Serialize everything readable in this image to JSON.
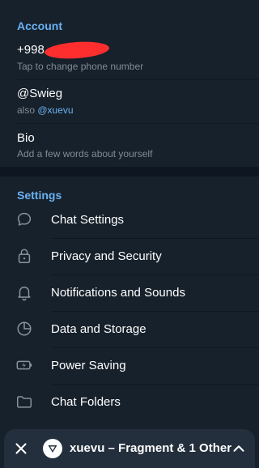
{
  "account": {
    "title": "Account",
    "phone": {
      "value": "+998",
      "hint": "Tap to change phone number"
    },
    "username": {
      "value": "@Swieg",
      "hint_prefix": "also ",
      "hint_mention": "@xuevu"
    },
    "bio": {
      "value": "Bio",
      "hint": "Add a few words about yourself"
    }
  },
  "settings": {
    "title": "Settings",
    "items": [
      {
        "label": "Chat Settings",
        "icon": "chat-bubble-icon"
      },
      {
        "label": "Privacy and Security",
        "icon": "lock-icon"
      },
      {
        "label": "Notifications and Sounds",
        "icon": "bell-icon"
      },
      {
        "label": "Data and Storage",
        "icon": "pie-clock-icon"
      },
      {
        "label": "Power Saving",
        "icon": "battery-icon"
      },
      {
        "label": "Chat Folders",
        "icon": "folder-icon"
      }
    ]
  },
  "bottom_bar": {
    "title": "xuevu – Fragment & 1 Other"
  },
  "colors": {
    "background": "#0e1621",
    "section": "#17212b",
    "accent": "#6ab2f2",
    "hint": "#7f8b95",
    "redaction": "#ff2e2e"
  }
}
